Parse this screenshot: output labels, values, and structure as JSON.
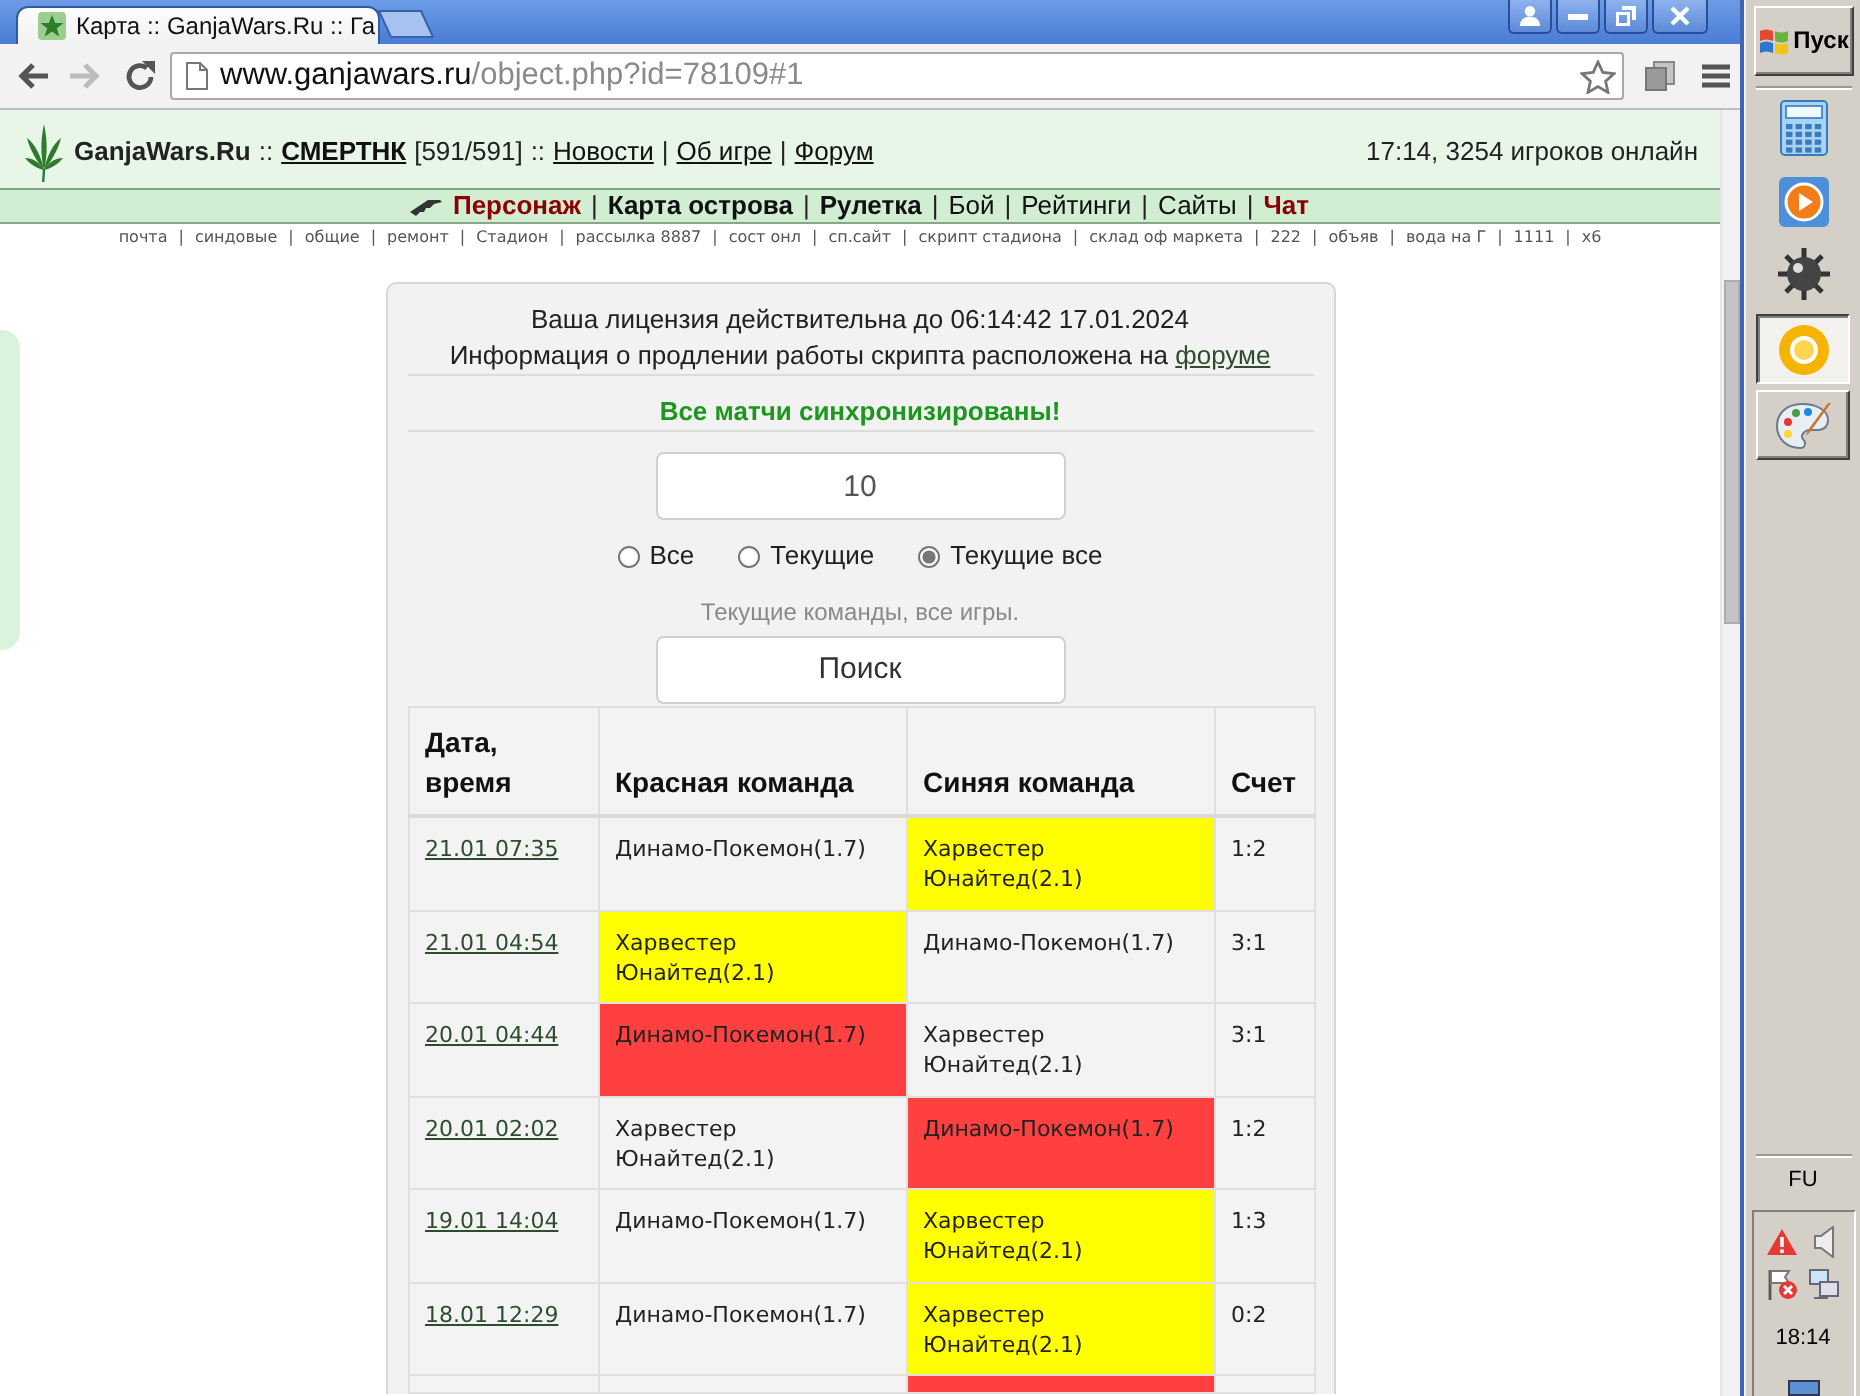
{
  "browser": {
    "tabs": [
      {
        "title": "Карта :: GanjaWars.Ru :: Га",
        "selected": true
      }
    ],
    "nav_buttons": [
      {
        "kind": "back",
        "disabled": false
      },
      {
        "kind": "forward",
        "disabled": true
      },
      {
        "kind": "reload",
        "disabled": false
      }
    ],
    "address": {
      "host": "www.ganjawars.ru",
      "path": "/object.php?id=78109#1"
    }
  },
  "site_header": {
    "segments": [
      {
        "kind": "brand",
        "text": "GanjaWars.Ru"
      },
      {
        "kind": "separator",
        "text": "::"
      },
      {
        "kind": "user",
        "text": "СМЕРТНК"
      },
      {
        "kind": "text",
        "text": "[591/591]"
      },
      {
        "kind": "separator",
        "text": "::"
      },
      {
        "kind": "link",
        "text": "Новости"
      },
      {
        "kind": "separator",
        "text": "|"
      },
      {
        "kind": "link",
        "text": "Об игре"
      },
      {
        "kind": "separator",
        "text": "|"
      },
      {
        "kind": "link",
        "text": "Форум"
      }
    ],
    "online": "17:14, 3254 игроков онлайн"
  },
  "main_nav": {
    "separator": "|",
    "items": [
      {
        "label": "Персонаж",
        "kind": "accent"
      },
      {
        "label": "Карта острова",
        "kind": "bold"
      },
      {
        "label": "Рулетка",
        "kind": "bold"
      },
      {
        "label": "Бой",
        "kind": "plain"
      },
      {
        "label": "Рейтинги",
        "kind": "plain"
      },
      {
        "label": "Сайты",
        "kind": "plain"
      },
      {
        "label": "Чат",
        "kind": "accent"
      }
    ]
  },
  "quick_links": {
    "separator": "|",
    "items": [
      "почта",
      "синдовые",
      "общие",
      "ремонт",
      "Стадион",
      "рассылка 8887",
      "сост онл",
      "сп.сайт",
      "скрипт стадиона",
      "склад оф маркета",
      "222",
      "объяв",
      "вода на Г",
      "1111",
      "х6"
    ]
  },
  "panel": {
    "license": "Ваша лицензия действительна до 06:14:42 17.01.2024",
    "info": {
      "text": "Информация о продлении работы скрипта расположена на",
      "link": "форуме"
    },
    "sync_status": "Все матчи синхронизированы!",
    "count_field": {
      "value": "10"
    },
    "filters": [
      {
        "label": "Все",
        "selected": false
      },
      {
        "label": "Текущие",
        "selected": false
      },
      {
        "label": "Текущие все",
        "selected": true
      }
    ],
    "filter_hint": "Текущие команды, все игры.",
    "search_button": "Поиск",
    "table": {
      "columns": [
        "Дата, время",
        "Красная команда",
        "Синяя команда",
        "Счет"
      ],
      "rows": [
        {
          "date": "21.01 07:35",
          "red": {
            "name": "Динамо-Покемон(1.7)"
          },
          "blue": {
            "name": "Харвестер Юнайтед(2.1)",
            "color": "#ffff00"
          },
          "score": "1:2"
        },
        {
          "date": "21.01 04:54",
          "red": {
            "name": "Харвестер Юнайтед(2.1)",
            "color": "#ffff00"
          },
          "blue": {
            "name": "Динамо-Покемон(1.7)"
          },
          "score": "3:1"
        },
        {
          "date": "20.01 04:44",
          "red": {
            "name": "Динамо-Покемон(1.7)",
            "color": "#ff4040"
          },
          "blue": {
            "name": "Харвестер Юнайтед(2.1)"
          },
          "score": "3:1"
        },
        {
          "date": "20.01 02:02",
          "red": {
            "name": "Харвестер Юнайтед(2.1)"
          },
          "blue": {
            "name": "Динамо-Покемон(1.7)",
            "color": "#ff4040"
          },
          "score": "1:2"
        },
        {
          "date": "19.01 14:04",
          "red": {
            "name": "Динамо-Покемон(1.7)"
          },
          "blue": {
            "name": "Харвестер Юнайтед(2.1)",
            "color": "#ffff00"
          },
          "score": "1:3"
        },
        {
          "date": "18.01 12:29",
          "red": {
            "name": "Динамо-Покемон(1.7)"
          },
          "blue": {
            "name": "Харвестер Юнайтед(2.1)",
            "color": "#ffff00"
          },
          "score": "0:2"
        },
        {
          "blue": {
            "color": "#ff4040"
          }
        }
      ]
    }
  },
  "taskbar": {
    "start": "Пуск",
    "quick_launch": [
      {
        "kind": "calculator"
      },
      {
        "kind": "media"
      },
      {
        "kind": "mine"
      }
    ],
    "tasks": [
      {
        "kind": "browser",
        "selected": true
      },
      {
        "kind": "paint",
        "selected": false
      }
    ],
    "language": "FU",
    "tray": [
      {
        "kind": "warning"
      },
      {
        "kind": "speaker"
      },
      {
        "kind": "flag-error"
      },
      {
        "kind": "network"
      }
    ],
    "clock": "18:14"
  }
}
